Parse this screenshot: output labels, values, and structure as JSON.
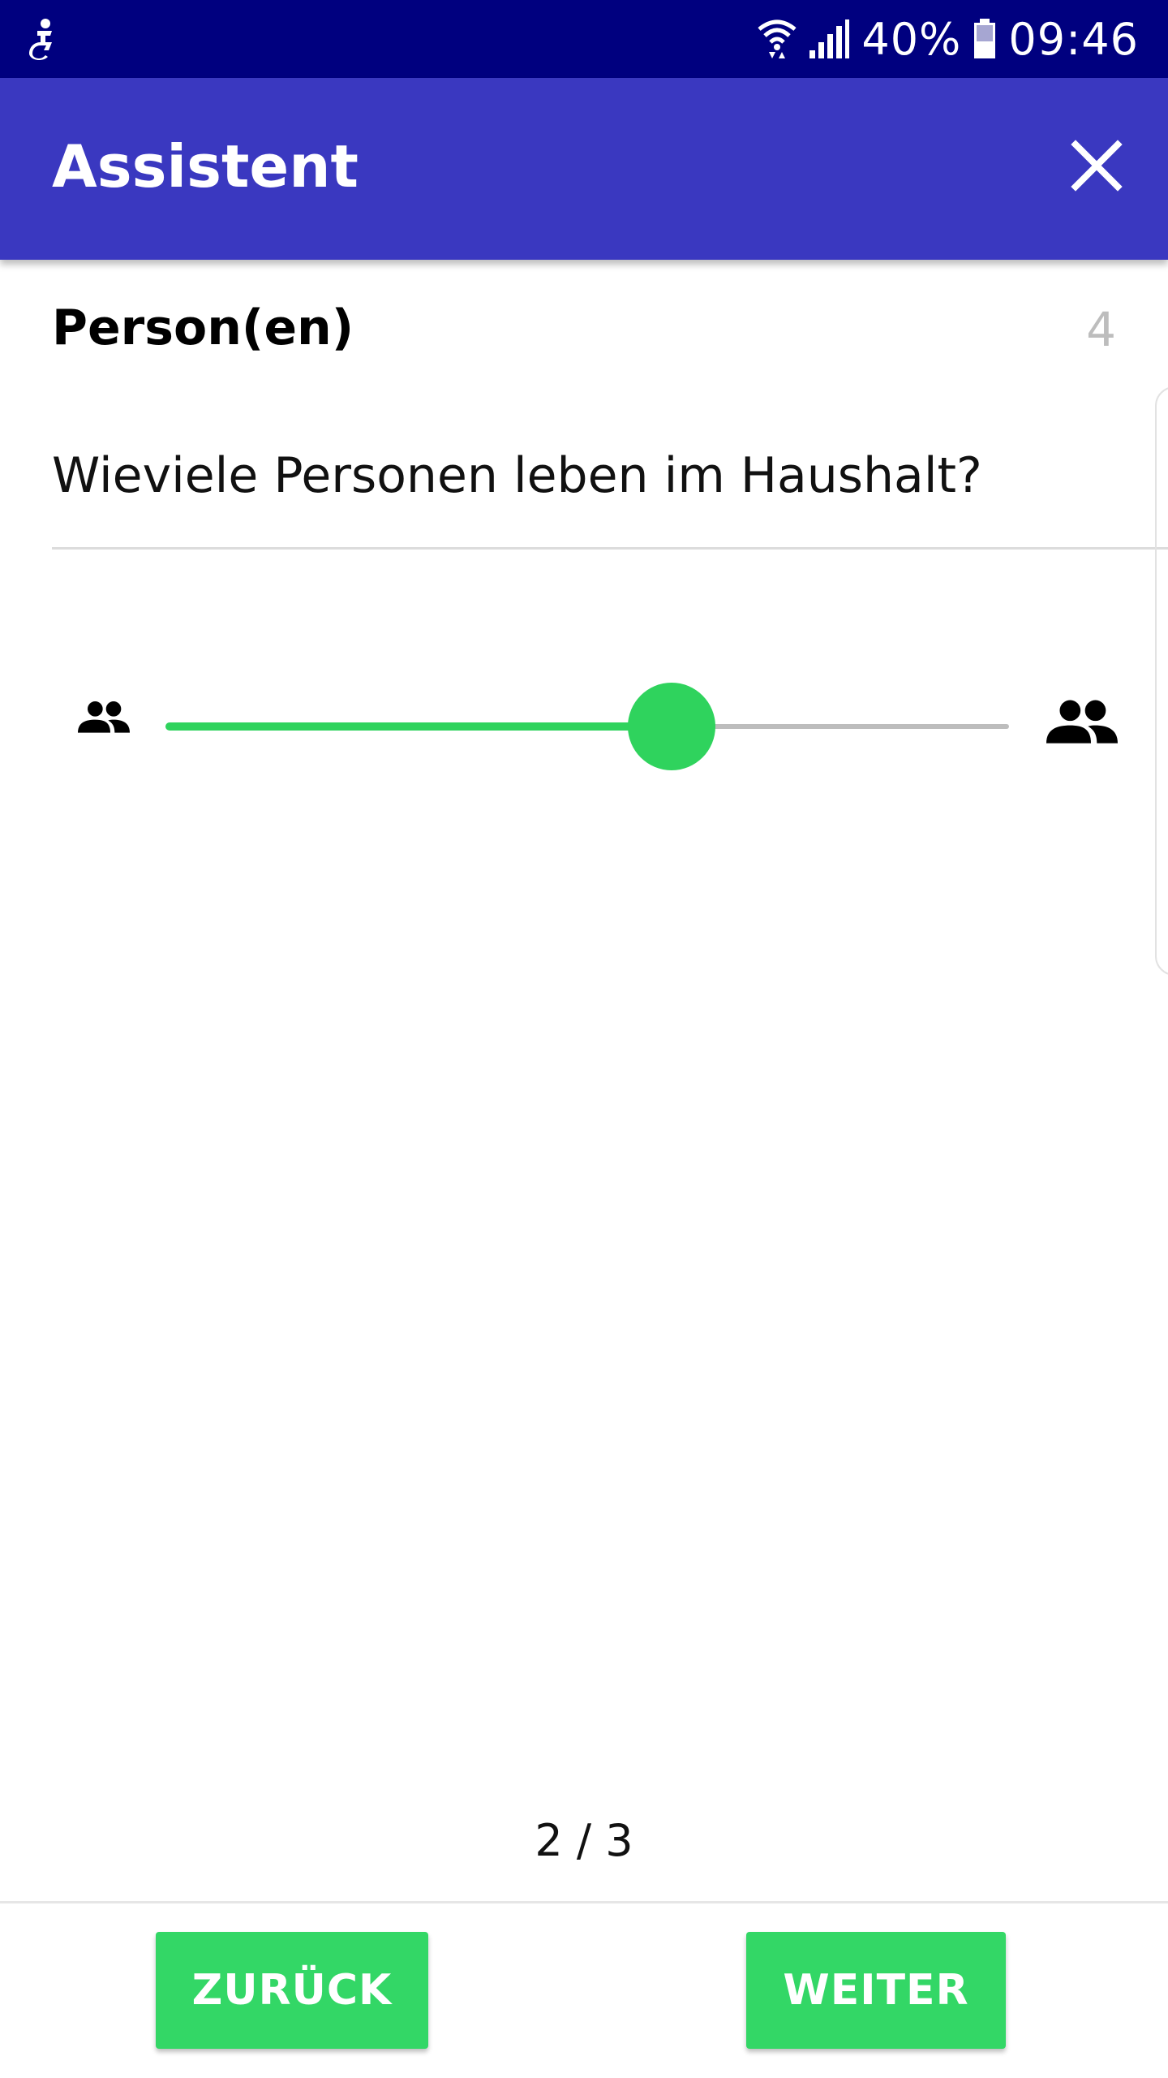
{
  "status_bar": {
    "left_icon": "accessibility-icon",
    "wifi_icon": "wifi-icon",
    "signal_icon": "signal-icon",
    "battery_percent": "40%",
    "battery_icon": "battery-icon",
    "time": "09:46"
  },
  "app_bar": {
    "title": "Assistent",
    "close_icon": "close-icon"
  },
  "section": {
    "title": "Person(en)",
    "count": "4"
  },
  "question": {
    "text": "Wieviele Personen leben im Haushalt?"
  },
  "slider": {
    "value_fraction": 0.6,
    "min_icon": "people-icon",
    "max_icon": "people-icon"
  },
  "pager": {
    "text": "2 / 3"
  },
  "buttons": {
    "back_label": "ZURÜCK",
    "next_label": "WEITER"
  },
  "colors": {
    "status_bar": "#00007f",
    "app_bar": "#3a38c0",
    "accent_green": "#2fd35d",
    "button_green": "#33d766",
    "track_gray": "#bdbdbd"
  }
}
